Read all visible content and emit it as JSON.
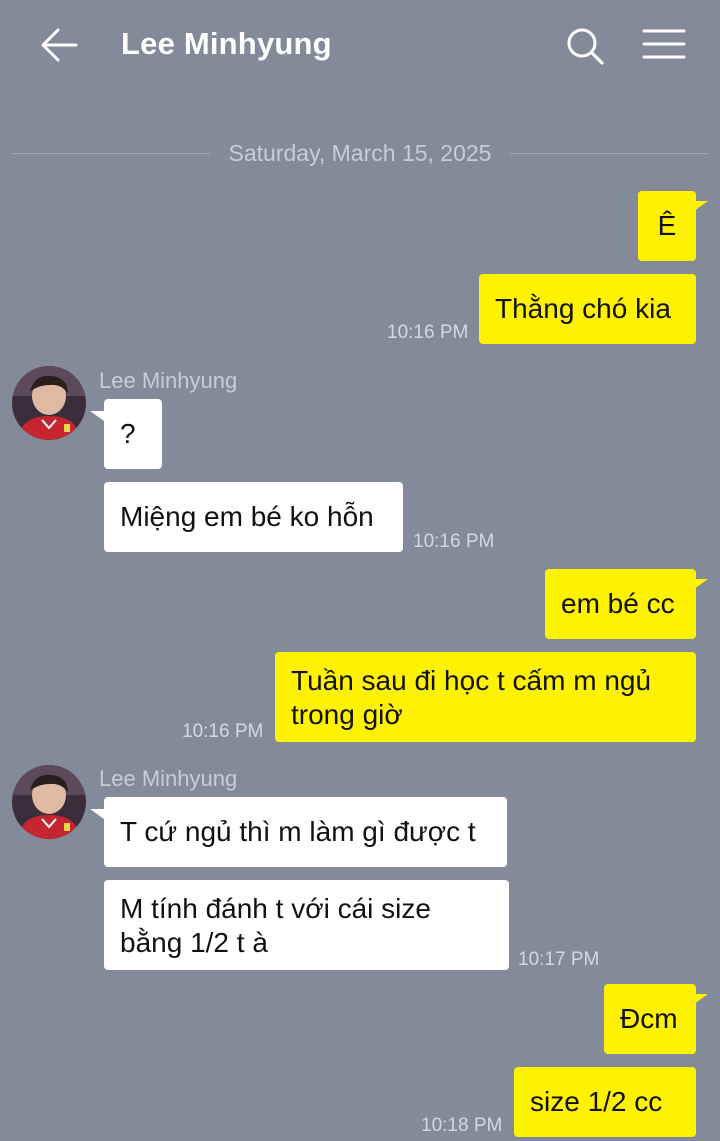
{
  "header": {
    "title": "Lee Minhyung",
    "icons": [
      "back-arrow-icon",
      "search-icon",
      "menu-icon"
    ]
  },
  "date_divider": "Saturday, March 15, 2025",
  "colors": {
    "background": "#838b9b",
    "my_bubble": "#fff200",
    "their_bubble": "#ffffff"
  },
  "messages": [
    {
      "from": "me",
      "text": "Ê"
    },
    {
      "from": "me",
      "text": "Thằng chó kia",
      "time": "10:16 PM"
    },
    {
      "from": "them",
      "sender": "Lee Minhyung",
      "text": "?"
    },
    {
      "from": "them",
      "text": "Miệng em bé ko hỗn",
      "time": "10:16 PM"
    },
    {
      "from": "me",
      "text": "em bé cc"
    },
    {
      "from": "me",
      "lines": [
        "Tuần sau đi học t cấm m ngủ",
        "trong giờ"
      ],
      "time": "10:16 PM"
    },
    {
      "from": "them",
      "sender": "Lee Minhyung",
      "text": "T cứ ngủ thì m làm gì được t"
    },
    {
      "from": "them",
      "lines": [
        "M tính đánh t với cái size",
        "bằng 1/2 t à"
      ],
      "time": "10:17 PM"
    },
    {
      "from": "me",
      "text": "Đcm"
    },
    {
      "from": "me",
      "text": "size 1/2 cc",
      "time": "10:18 PM"
    }
  ]
}
